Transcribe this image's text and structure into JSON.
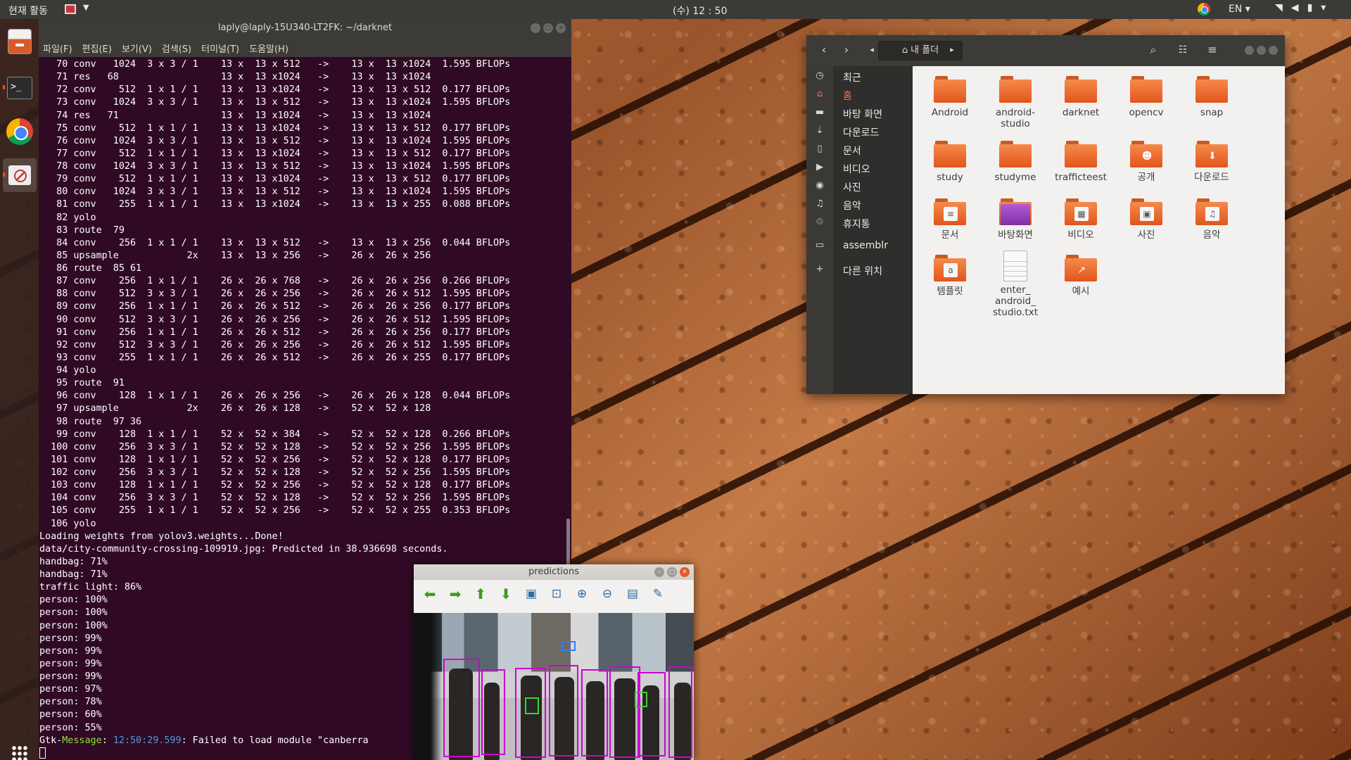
{
  "topbar": {
    "activities": "현재 활동",
    "clock": "(수) 12 : 50",
    "lang": "EN ▾",
    "tray_icons": [
      "wifi-icon",
      "volume-icon",
      "battery-icon",
      "power-menu-icon"
    ]
  },
  "dock": {
    "items": [
      "files",
      "terminal",
      "chrome",
      "predictions"
    ]
  },
  "terminal": {
    "title": "laply@laply-15U340-LT2FK: ~/darknet",
    "menu": [
      "파일(F)",
      "편집(E)",
      "보기(V)",
      "검색(S)",
      "터미널(T)",
      "도움말(H)"
    ],
    "lines": [
      "   70 conv   1024  3 x 3 / 1    13 x  13 x 512   ->    13 x  13 x1024  1.595 BFLOPs",
      "   71 res   68                  13 x  13 x1024   ->    13 x  13 x1024",
      "   72 conv    512  1 x 1 / 1    13 x  13 x1024   ->    13 x  13 x 512  0.177 BFLOPs",
      "   73 conv   1024  3 x 3 / 1    13 x  13 x 512   ->    13 x  13 x1024  1.595 BFLOPs",
      "   74 res   71                  13 x  13 x1024   ->    13 x  13 x1024",
      "   75 conv    512  1 x 1 / 1    13 x  13 x1024   ->    13 x  13 x 512  0.177 BFLOPs",
      "   76 conv   1024  3 x 3 / 1    13 x  13 x 512   ->    13 x  13 x1024  1.595 BFLOPs",
      "   77 conv    512  1 x 1 / 1    13 x  13 x1024   ->    13 x  13 x 512  0.177 BFLOPs",
      "   78 conv   1024  3 x 3 / 1    13 x  13 x 512   ->    13 x  13 x1024  1.595 BFLOPs",
      "   79 conv    512  1 x 1 / 1    13 x  13 x1024   ->    13 x  13 x 512  0.177 BFLOPs",
      "   80 conv   1024  3 x 3 / 1    13 x  13 x 512   ->    13 x  13 x1024  1.595 BFLOPs",
      "   81 conv    255  1 x 1 / 1    13 x  13 x1024   ->    13 x  13 x 255  0.088 BFLOPs",
      "   82 yolo",
      "   83 route  79",
      "   84 conv    256  1 x 1 / 1    13 x  13 x 512   ->    13 x  13 x 256  0.044 BFLOPs",
      "   85 upsample            2x    13 x  13 x 256   ->    26 x  26 x 256",
      "   86 route  85 61",
      "   87 conv    256  1 x 1 / 1    26 x  26 x 768   ->    26 x  26 x 256  0.266 BFLOPs",
      "   88 conv    512  3 x 3 / 1    26 x  26 x 256   ->    26 x  26 x 512  1.595 BFLOPs",
      "   89 conv    256  1 x 1 / 1    26 x  26 x 512   ->    26 x  26 x 256  0.177 BFLOPs",
      "   90 conv    512  3 x 3 / 1    26 x  26 x 256   ->    26 x  26 x 512  1.595 BFLOPs",
      "   91 conv    256  1 x 1 / 1    26 x  26 x 512   ->    26 x  26 x 256  0.177 BFLOPs",
      "   92 conv    512  3 x 3 / 1    26 x  26 x 256   ->    26 x  26 x 512  1.595 BFLOPs",
      "   93 conv    255  1 x 1 / 1    26 x  26 x 512   ->    26 x  26 x 255  0.177 BFLOPs",
      "   94 yolo",
      "   95 route  91",
      "   96 conv    128  1 x 1 / 1    26 x  26 x 256   ->    26 x  26 x 128  0.044 BFLOPs",
      "   97 upsample            2x    26 x  26 x 128   ->    52 x  52 x 128",
      "   98 route  97 36",
      "   99 conv    128  1 x 1 / 1    52 x  52 x 384   ->    52 x  52 x 128  0.266 BFLOPs",
      "  100 conv    256  3 x 3 / 1    52 x  52 x 128   ->    52 x  52 x 256  1.595 BFLOPs",
      "  101 conv    128  1 x 1 / 1    52 x  52 x 256   ->    52 x  52 x 128  0.177 BFLOPs",
      "  102 conv    256  3 x 3 / 1    52 x  52 x 128   ->    52 x  52 x 256  1.595 BFLOPs",
      "  103 conv    128  1 x 1 / 1    52 x  52 x 256   ->    52 x  52 x 128  0.177 BFLOPs",
      "  104 conv    256  3 x 3 / 1    52 x  52 x 128   ->    52 x  52 x 256  1.595 BFLOPs",
      "  105 conv    255  1 x 1 / 1    52 x  52 x 256   ->    52 x  52 x 255  0.353 BFLOPs",
      "  106 yolo",
      "Loading weights from yolov3.weights...Done!",
      "data/city-community-crossing-109919.jpg: Predicted in 38.936698 seconds.",
      "handbag: 71%",
      "handbag: 71%",
      "traffic light: 86%",
      "person: 100%",
      "person: 100%",
      "person: 100%",
      "person: 99%",
      "person: 99%",
      "person: 99%",
      "person: 99%",
      "person: 97%",
      "person: 78%",
      "person: 60%",
      "person: 55%"
    ],
    "gtk_prefix": "Gtk-",
    "gtk_label": "Message",
    "gtk_colon": ": ",
    "gtk_time": "12:50:29.599",
    "gtk_text": ": Failed to load module \"canberra"
  },
  "predictions": {
    "title": "predictions",
    "toolbar": [
      "arrow-left-icon",
      "arrow-right-icon",
      "arrow-up-icon",
      "arrow-down-icon",
      "image-icon",
      "fit-window-icon",
      "zoom-in-icon",
      "zoom-out-icon",
      "save-icon",
      "brush-icon"
    ]
  },
  "files": {
    "path_label": "내 폴더",
    "sidebar": [
      {
        "icon": "clock-icon",
        "label": "최근"
      },
      {
        "icon": "home-icon",
        "label": "홈",
        "active": true
      },
      {
        "icon": "folder-icon",
        "label": "바탕 화면"
      },
      {
        "icon": "download-icon",
        "label": "다운로드"
      },
      {
        "icon": "document-icon",
        "label": "문서"
      },
      {
        "icon": "video-icon",
        "label": "비디오"
      },
      {
        "icon": "camera-icon",
        "label": "사진"
      },
      {
        "icon": "music-icon",
        "label": "음악"
      },
      {
        "icon": "trash-icon",
        "label": "휴지통"
      },
      {
        "icon": "drive-icon",
        "label": "assemblr"
      },
      {
        "icon": "plus-icon",
        "label": "다른 위치"
      }
    ],
    "items": [
      {
        "label": "Android",
        "type": "folder"
      },
      {
        "label": "android-\nstudio",
        "type": "folder"
      },
      {
        "label": "darknet",
        "type": "folder"
      },
      {
        "label": "opencv",
        "type": "folder"
      },
      {
        "label": "snap",
        "type": "folder"
      },
      {
        "label": "study",
        "type": "folder"
      },
      {
        "label": "studyme",
        "type": "folder"
      },
      {
        "label": "trafficteest",
        "type": "folder"
      },
      {
        "label": "공개",
        "type": "folder-public"
      },
      {
        "label": "다운로드",
        "type": "folder-download"
      },
      {
        "label": "문서",
        "type": "folder-documents"
      },
      {
        "label": "바탕화면",
        "type": "folder-desktop"
      },
      {
        "label": "비디오",
        "type": "folder-video"
      },
      {
        "label": "사진",
        "type": "folder-pictures"
      },
      {
        "label": "음악",
        "type": "folder-music"
      },
      {
        "label": "템플릿",
        "type": "folder-templates"
      },
      {
        "label": "enter_\nandroid_\nstudio.txt",
        "type": "text-file"
      },
      {
        "label": "예시",
        "type": "folder-link"
      }
    ]
  }
}
